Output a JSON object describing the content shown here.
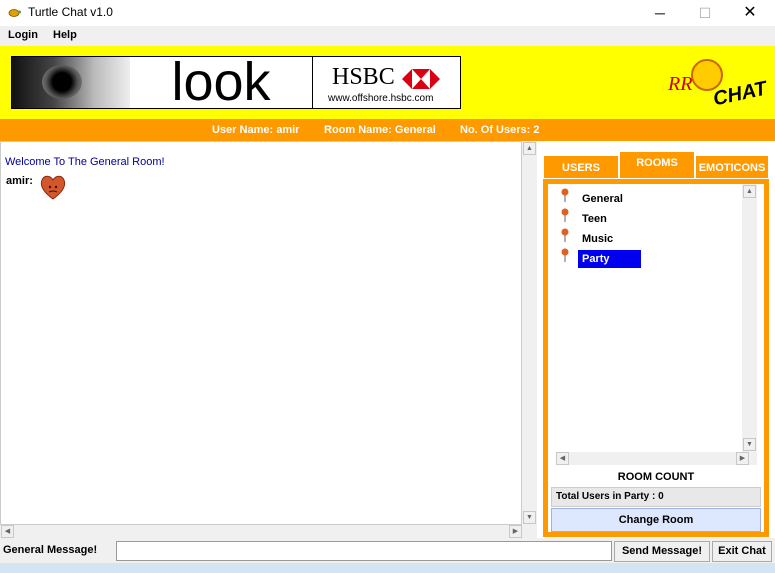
{
  "window": {
    "title": "Turtle Chat v1.0",
    "controls": {
      "minimize": "─",
      "maximize": "☐",
      "close": "✕"
    }
  },
  "menu": {
    "items": [
      "Login",
      "Help"
    ]
  },
  "banner": {
    "ad_text": "look",
    "ad_brand": "HSBC",
    "ad_url": "www.offshore.hsbc.com",
    "logo_rr": "RR",
    "logo_chat": "CHAT",
    "colors": {
      "background": "#ffff00",
      "accent": "#ff9900"
    }
  },
  "info": {
    "user_name": "User Name: amir",
    "room_name": "Room Name: General",
    "users_count": "No. Of Users: 2"
  },
  "chat": {
    "welcome": "Welcome To The General Room!",
    "messages": [
      {
        "user": "amir:",
        "content_icon": "heart-icon"
      }
    ]
  },
  "tabs": [
    "USERS",
    "ROOMS",
    "EMOTICONS"
  ],
  "active_tab": "ROOMS",
  "rooms": {
    "items": [
      "General",
      "Teen",
      "Music",
      "Party"
    ],
    "selected": "Party",
    "room_count_label": "ROOM COUNT",
    "total_users": "Total Users in Party : 0",
    "change_room": "Change Room"
  },
  "bottom": {
    "label": "General Message!",
    "message_value": "",
    "send": "Send Message!",
    "exit": "Exit Chat"
  }
}
